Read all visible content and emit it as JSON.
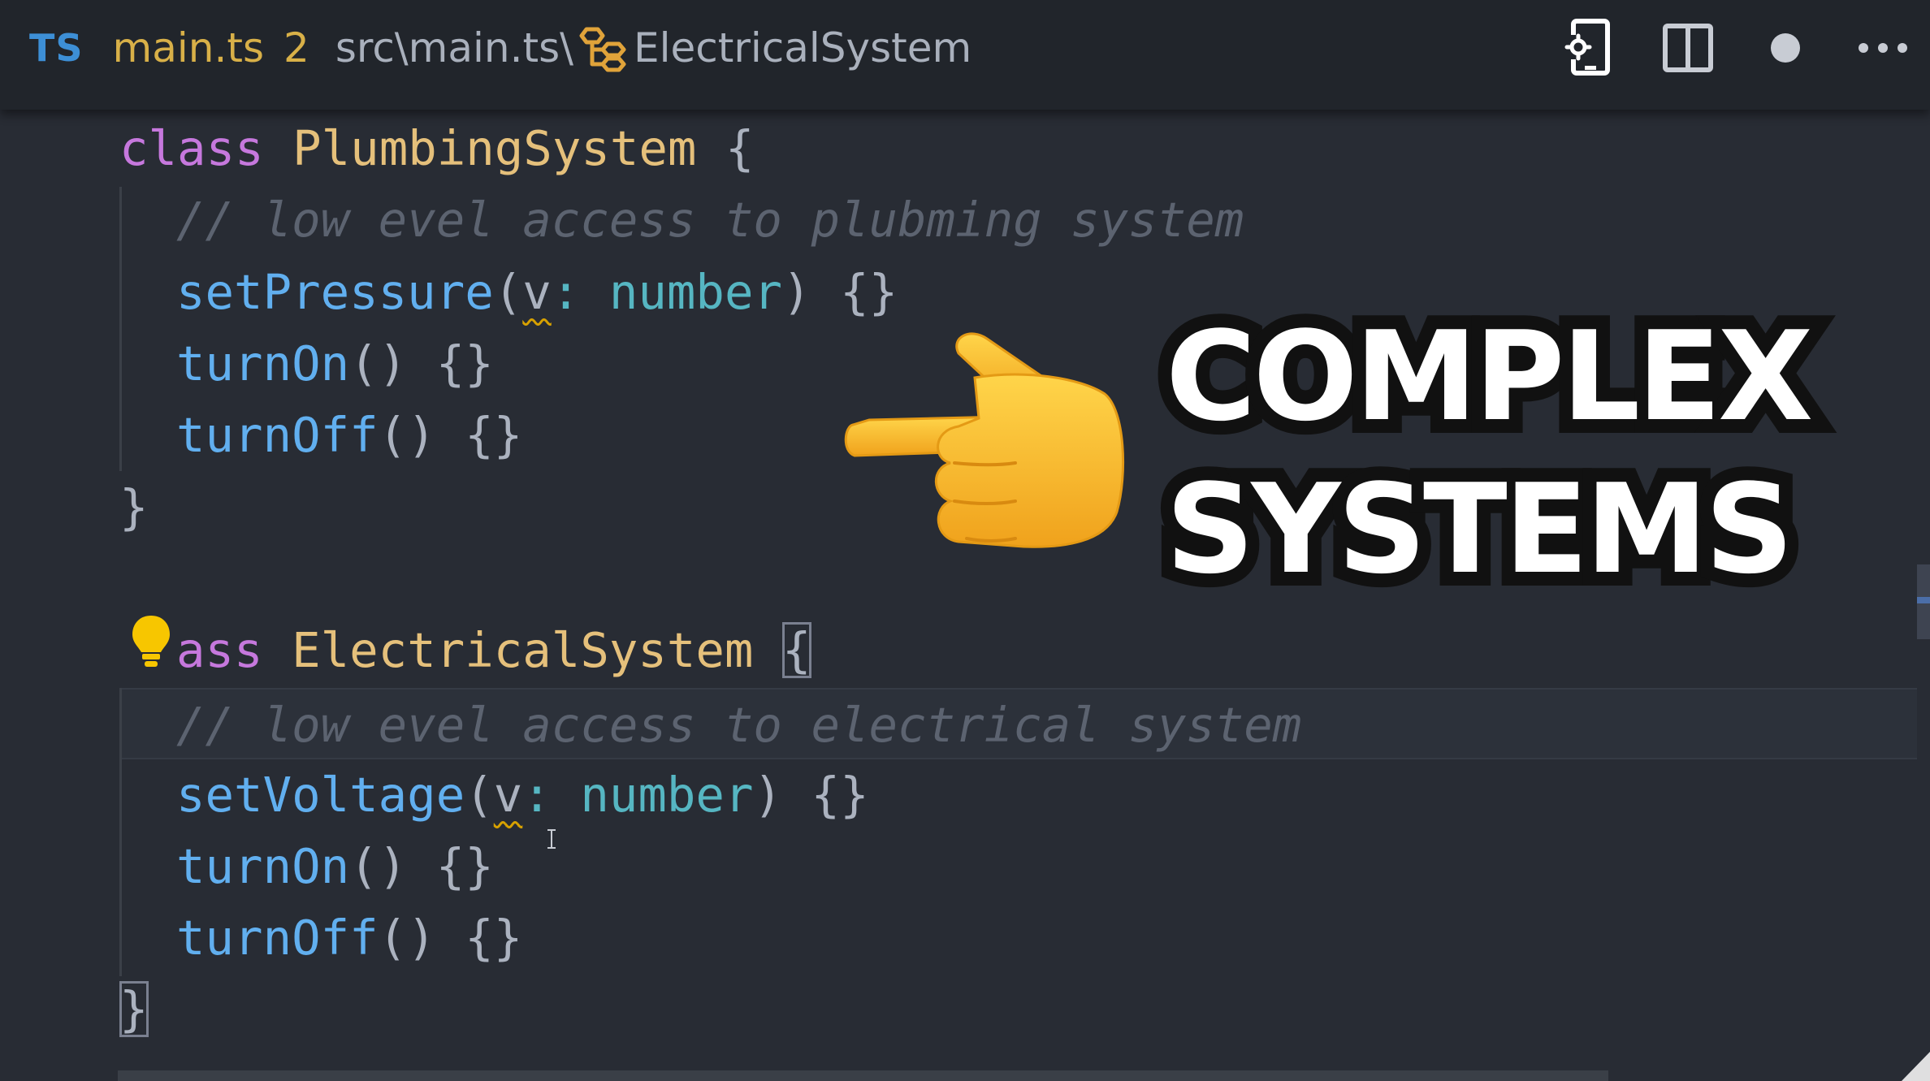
{
  "breadcrumb": {
    "language_badge": "TS",
    "file_name": "main.ts",
    "problem_count": "2",
    "path": "src\\main.ts\\",
    "class_name": "ElectricalSystem",
    "icons": [
      "class-symbol-icon"
    ]
  },
  "actions": {
    "icons": [
      "open-changes-icon",
      "split-editor-icon",
      "unsaved-dot-icon",
      "more-actions-icon"
    ]
  },
  "code": {
    "class1_keyword": "class",
    "class1_name": "PlumbingSystem",
    "open_brace": "{",
    "close_brace": "}",
    "class1_comment": "// low evel access to plubming system",
    "method_set_pressure": "setPressure",
    "method_set_voltage": "setVoltage",
    "method_turn_on": "turnOn",
    "method_turn_off": "turnOff",
    "param_name": "v",
    "param_colon": ":",
    "param_type": "number",
    "paren_open": "(",
    "paren_close": ")",
    "empty_parens": "()",
    "empty_body": "{}",
    "class2_keyword_visible": "ass",
    "class2_name": "ElectricalSystem",
    "class2_comment": "// low evel access to electrical system"
  },
  "overlay": {
    "line1": "COMPLEX",
    "line2": "SYSTEMS",
    "hand_color": "#f6b92b"
  },
  "colors": {
    "background": "#282c34",
    "keyword": "#c678dd",
    "class_name": "#e5c07b",
    "function": "#61afef",
    "type": "#56b6c2",
    "comment": "#5c6370",
    "file_name": "#d8b048",
    "ts_badge": "#3d8fd6"
  }
}
